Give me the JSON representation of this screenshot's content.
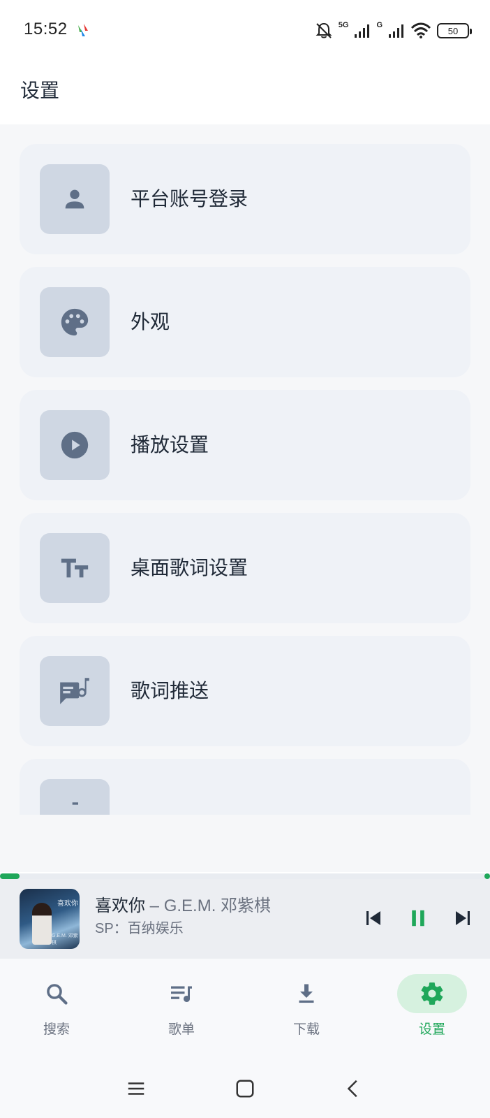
{
  "status_bar": {
    "time": "15:52",
    "network_1": "5G",
    "network_2": "G",
    "battery": "50"
  },
  "header": {
    "title": "设置"
  },
  "settings": [
    {
      "label": "平台账号登录",
      "icon": "person-icon"
    },
    {
      "label": "外观",
      "icon": "palette-icon"
    },
    {
      "label": "播放设置",
      "icon": "play-circle-icon"
    },
    {
      "label": "桌面歌词设置",
      "icon": "text-size-icon"
    },
    {
      "label": "歌词推送",
      "icon": "lyrics-icon"
    },
    {
      "label": "",
      "icon": "partial-icon"
    }
  ],
  "player": {
    "title": "喜欢你",
    "separator": " – ",
    "artist": "G.E.M. 邓紫棋",
    "source": "SP：百纳娱乐",
    "progress": 0.04,
    "state": "playing",
    "album_art_text": "喜欢你",
    "album_art_sub": "G.E.M. 邓紫棋"
  },
  "nav": [
    {
      "label": "搜索",
      "icon": "search-icon",
      "active": false
    },
    {
      "label": "歌单",
      "icon": "playlist-icon",
      "active": false
    },
    {
      "label": "下载",
      "icon": "download-icon",
      "active": false
    },
    {
      "label": "设置",
      "icon": "gear-icon",
      "active": true
    }
  ],
  "colors": {
    "accent": "#1fa75a",
    "accent_soft": "#d6f1df",
    "card_bg": "#eff2f7",
    "icon_tile": "#cfd7e3",
    "icon_fg": "#5f6f87"
  }
}
